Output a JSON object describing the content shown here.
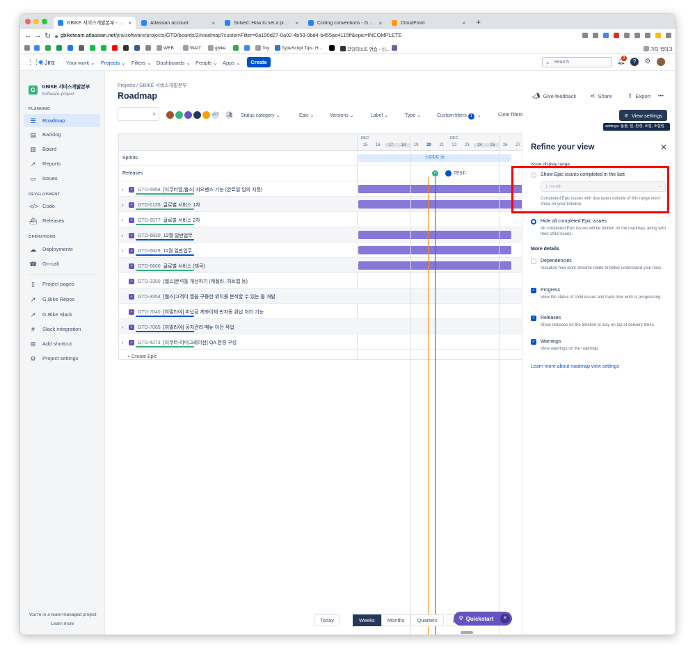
{
  "browser": {
    "tabs": [
      {
        "label": "GBIKE 서비스개발본부 - Roadmap",
        "color": "#2684FF",
        "active": true
      },
      {
        "label": "Atlassian account",
        "color": "#2684FF",
        "active": false
      },
      {
        "label": "Solved: How to set a predefined...",
        "color": "#2684FF",
        "active": false
      },
      {
        "label": "Coding conventions - GBIKE Bi...",
        "color": "#2684FF",
        "active": false
      },
      {
        "label": "CloudFront",
        "color": "#FF9900",
        "active": false
      }
    ],
    "url_host": "gbiketeam.atlassian.net",
    "url_path": "/jira/software/projects/GTD/boards/2/roadmap?customFilter=6a190d27-0a02-4b58-9bd4-b455ae4115ff&epic=INCOMPLETE",
    "bookmarks": [
      "WEB",
      "WAIT",
      "gbike",
      "Toy",
      "TypeScript Tips: H...",
      "코딩테스트 연습 - 신...",
      "기타 북마크"
    ]
  },
  "topnav": {
    "logo": "Jira",
    "items": [
      "Your work",
      "Projects",
      "Filters",
      "Dashboards",
      "People",
      "Apps"
    ],
    "create": "Create",
    "search_placeholder": "Search",
    "notif_count": "2"
  },
  "sidebar": {
    "project_name": "GBIKE 서비스개발본부",
    "project_type": "Software project",
    "planning_header": "PLANNING",
    "planning": [
      {
        "label": "Roadmap",
        "icon": "roadmap-icon",
        "active": true
      },
      {
        "label": "Backlog",
        "icon": "backlog-icon"
      },
      {
        "label": "Board",
        "icon": "board-icon"
      },
      {
        "label": "Reports",
        "icon": "reports-icon"
      },
      {
        "label": "Issues",
        "icon": "issues-icon"
      }
    ],
    "development_header": "DEVELOPMENT",
    "development": [
      {
        "label": "Code",
        "icon": "code-icon"
      },
      {
        "label": "Releases",
        "icon": "releases-icon"
      }
    ],
    "operations_header": "OPERATIONS",
    "operations": [
      {
        "label": "Deployments",
        "icon": "deployments-icon"
      },
      {
        "label": "On-call",
        "icon": "on-call-icon"
      }
    ],
    "other": [
      {
        "label": "Project pages",
        "icon": "pages-icon"
      },
      {
        "label": "G.Bike Repos",
        "icon": "repo-icon"
      },
      {
        "label": "G.Bike Slack",
        "icon": "slack-link-icon"
      },
      {
        "label": "Slack integration",
        "icon": "slack-icon"
      },
      {
        "label": "Add shortcut",
        "icon": "add-shortcut-icon"
      },
      {
        "label": "Project settings",
        "icon": "settings-icon"
      }
    ],
    "footer_text": "You're in a team-managed project",
    "footer_link": "Learn more"
  },
  "page": {
    "breadcrumb_projects": "Projects",
    "breadcrumb_sep": "/",
    "breadcrumb_project": "GBIKE 서비스개발본부",
    "title": "Roadmap",
    "actions": {
      "feedback": "Give feedback",
      "share": "Share",
      "export": "Export",
      "more": "•••"
    }
  },
  "filters": {
    "avatars_more": "+27",
    "status_category": "Status category",
    "epic": "Epic",
    "versions": "Versions",
    "label": "Label",
    "type": "Type",
    "custom_filters": "Custom filters",
    "custom_filters_count": "1",
    "clear": "Clear filters",
    "view_settings": "View settings",
    "tooltip": "settings: 놀음, 짐, 환경, 조절, 조절림"
  },
  "timeline": {
    "month1": "DEC",
    "month2": "DEC",
    "dates": [
      "15",
      "16",
      "17",
      "18",
      "19",
      "20",
      "21",
      "22",
      "23",
      "24",
      "25",
      "26",
      "27"
    ],
    "sprints_label": "Sprints",
    "sprint_name": "스프린트 35",
    "releases_label": "Releases",
    "release_name": "TEST-"
  },
  "epics": [
    {
      "key": "GTD-5958",
      "title": "[지쿠터앱,웹스] 지오펜스 기능 (완료일 임의 지정)",
      "expand": true,
      "progress_color": "#36B37E"
    },
    {
      "key": "GTD-6139",
      "title": "글로벌 서비스 1차",
      "expand": true,
      "progress_color": "#36B37E"
    },
    {
      "key": "GTD-6577",
      "title": "글로벌 서비스 2차",
      "expand": true,
      "progress_color": "#36B37E"
    },
    {
      "key": "GTD-6830",
      "title": "12월 일반업무",
      "expand": true,
      "progress_color": "#0052CC"
    },
    {
      "key": "GTD-6829",
      "title": "11월 일반업무",
      "expand": true,
      "progress_color": "#0052CC"
    },
    {
      "key": "GTD-6600",
      "title": "글로벌 서비스 (태국)",
      "expand": false,
      "progress_color": "#36B37E"
    },
    {
      "key": "GTD-3350",
      "title": "[웹스]분석툴 개선하기 (캐플러, 히트맵 등)",
      "expand": false,
      "progress_color": ""
    },
    {
      "key": "GTD-3354",
      "title": "[웹스]고객이 앱을 구동한 위치를 분석할 수 있는 툴 개발",
      "expand": false,
      "progress_color": ""
    },
    {
      "key": "GTD-7040",
      "title": "[히말라야] 미납금 계좌이체 반자동 완납 처리 기능",
      "expand": false,
      "progress_color": "#0052CC"
    },
    {
      "key": "GTD-7065",
      "title": "[히말라야] 공지관리 메뉴 이전 작업",
      "expand": true,
      "progress_color": "#0052CC"
    },
    {
      "key": "GTD-4273",
      "title": "[지쿠터-이미그레이션] QA 환경 구성",
      "expand": true,
      "progress_color": "#36B37E"
    }
  ],
  "create_epic": "+ Create Epic",
  "panel": {
    "title": "Refine your view",
    "range_header": "Issue display range",
    "show_completed_label": "Show Epic issues completed in the last",
    "range_value": "1 month",
    "range_desc": "Completed Epic issues with due dates outside of this range won't show on your timeline.",
    "hide_completed_label": "Hide all completed Epic issues",
    "hide_completed_desc": "All completed Epic issues will be hidden on the roadmap, along with their child issues.",
    "more_header": "More details",
    "options": [
      {
        "label": "Dependencies",
        "desc": "Visualize how work streams relate to better understand your risks.",
        "checked": false
      },
      {
        "label": "Progress",
        "desc": "View the status of child issues and track how work is progressing.",
        "checked": true
      },
      {
        "label": "Releases",
        "desc": "Show releases on the timeline to stay on top of delivery times",
        "checked": true
      },
      {
        "label": "Warnings",
        "desc": "View warnings on the roadmap.",
        "checked": true
      }
    ],
    "learn_more": "Learn more about roadmap view settings"
  },
  "bottom": {
    "today": "Today",
    "weeks": "Weeks",
    "months": "Months",
    "quarters": "Quarters",
    "quickstart": "Quickstart"
  }
}
